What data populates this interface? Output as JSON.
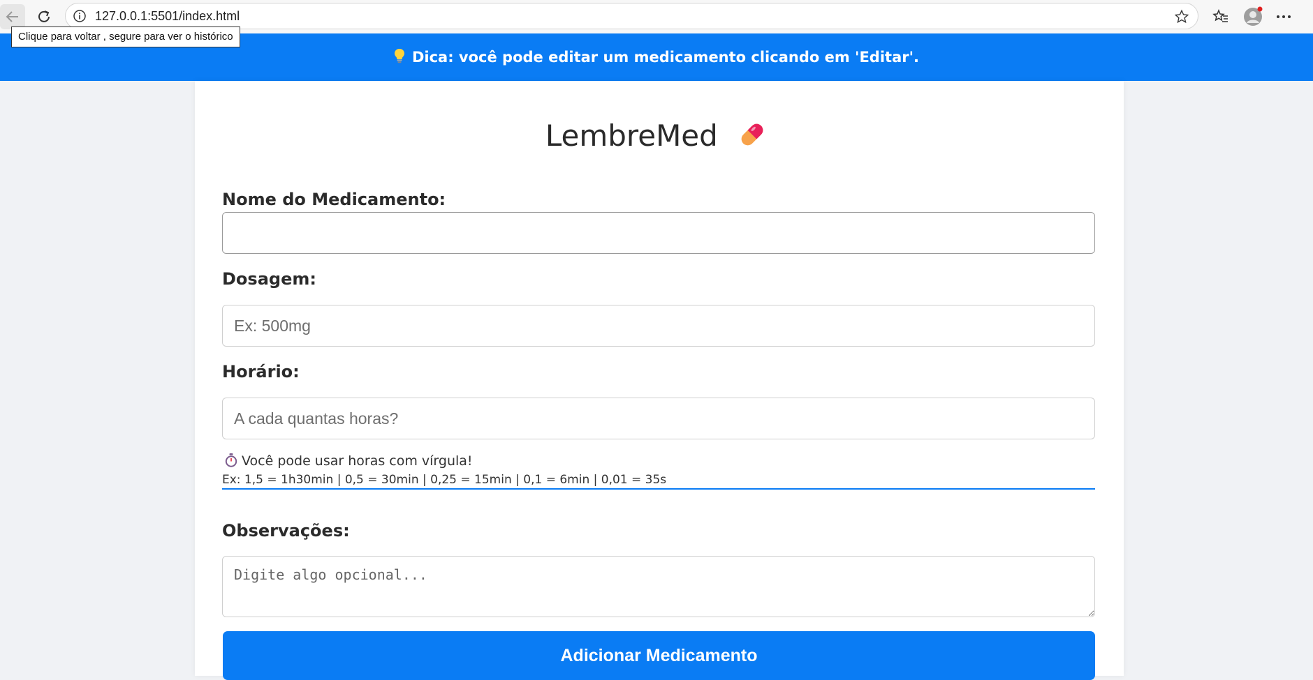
{
  "browser": {
    "url": "127.0.0.1:5501/index.html",
    "back_tooltip": "Clique para voltar , segure para ver o histórico"
  },
  "banner": {
    "icon": "lightbulb-icon",
    "text": "Dica: você pode editar um medicamento clicando em 'Editar'."
  },
  "app": {
    "title": "LembreMed",
    "title_icon": "pill-icon"
  },
  "form": {
    "name_label": "Nome do Medicamento:",
    "name_value": "",
    "dose_label": "Dosagem:",
    "dose_placeholder": "Ex: 500mg",
    "time_label": "Horário:",
    "time_placeholder": "A cada quantas horas?",
    "hint_icon": "stopwatch-icon",
    "hint_line1": "Você pode usar horas com vírgula!",
    "hint_line2": "Ex: 1,5 = 1h30min | 0,5 = 30min | 0,25 = 15min | 0,1 = 6min | 0,01 = 35s",
    "notes_label": "Observações:",
    "notes_placeholder": "Digite algo opcional...",
    "submit_label": "Adicionar Medicamento"
  },
  "colors": {
    "accent": "#0a7cf4",
    "background": "#f0f2f5"
  }
}
